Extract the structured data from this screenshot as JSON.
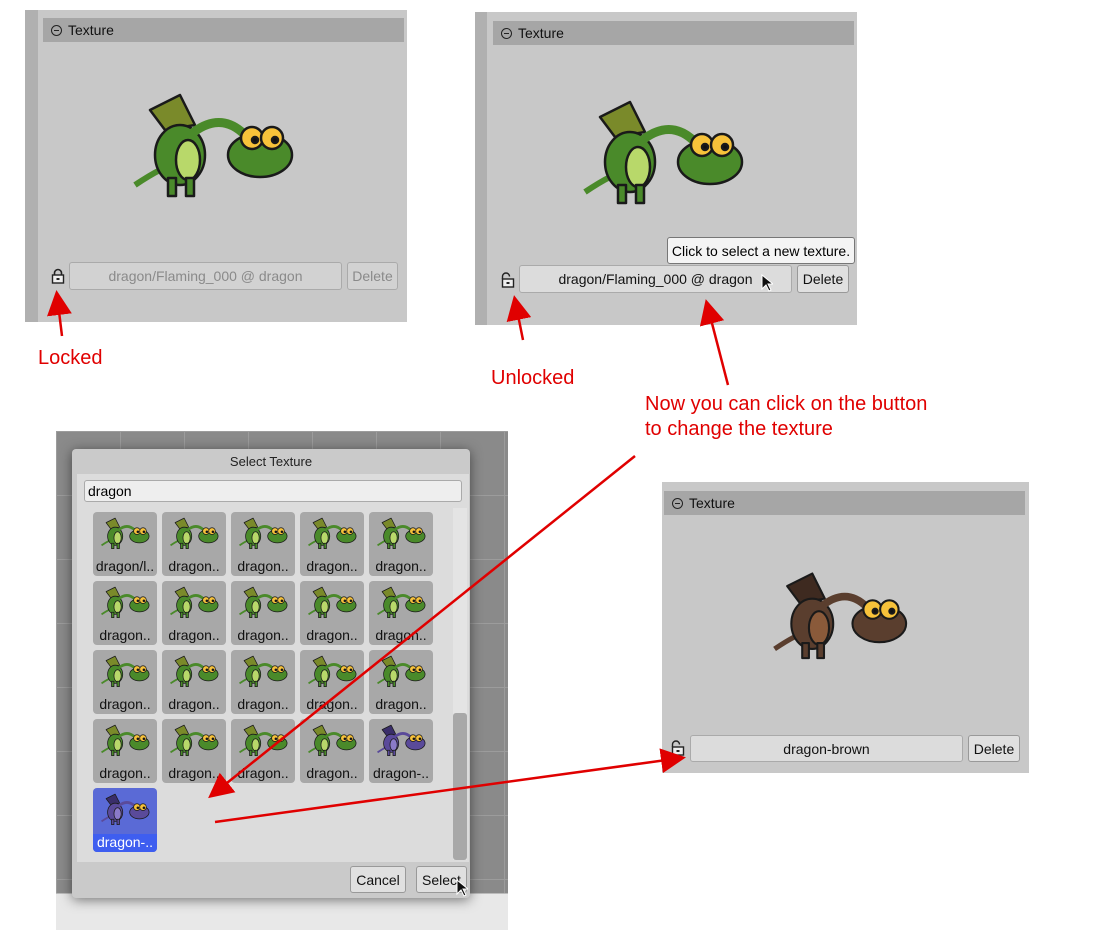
{
  "colors": {
    "annotation": "#e00000",
    "selected": "#3e5ef0",
    "green_dragon": "#4a8a2a",
    "brown_dragon": "#5a3e2e",
    "purple_dragon": "#5a4a9a"
  },
  "panel_locked": {
    "header": "Texture",
    "lock_icon": "lock-icon",
    "texture_button": "dragon/Flaming_000 @ dragon",
    "delete_label": "Delete"
  },
  "panel_unlocked": {
    "header": "Texture",
    "lock_icon": "unlock-icon",
    "texture_button": "dragon/Flaming_000 @ dragon",
    "delete_label": "Delete",
    "tooltip": "Click to select a new texture."
  },
  "panel_changed": {
    "header": "Texture",
    "lock_icon": "unlock-icon",
    "texture_button": "dragon-brown",
    "delete_label": "Delete"
  },
  "annotations": {
    "locked": "Locked",
    "unlocked": "Unlocked",
    "line1": "Now you can click on the button",
    "line2": "to change the texture"
  },
  "dialog": {
    "title": "Select Texture",
    "search_value": "dragon",
    "cancel_label": "Cancel",
    "select_label": "Select",
    "tiles": [
      {
        "label": "dragon/l..",
        "kind": "green"
      },
      {
        "label": "dragon..",
        "kind": "green"
      },
      {
        "label": "dragon..",
        "kind": "green"
      },
      {
        "label": "dragon..",
        "kind": "green"
      },
      {
        "label": "dragon..",
        "kind": "green"
      },
      {
        "label": "dragon..",
        "kind": "green"
      },
      {
        "label": "dragon..",
        "kind": "green"
      },
      {
        "label": "dragon..",
        "kind": "green"
      },
      {
        "label": "dragon..",
        "kind": "green"
      },
      {
        "label": "dragon..",
        "kind": "green"
      },
      {
        "label": "dragon..",
        "kind": "green"
      },
      {
        "label": "dragon..",
        "kind": "green"
      },
      {
        "label": "dragon..",
        "kind": "green"
      },
      {
        "label": "dragon..",
        "kind": "green"
      },
      {
        "label": "dragon..",
        "kind": "green"
      },
      {
        "label": "dragon..",
        "kind": "green"
      },
      {
        "label": "dragon..",
        "kind": "green"
      },
      {
        "label": "dragon..",
        "kind": "green"
      },
      {
        "label": "dragon..",
        "kind": "green"
      },
      {
        "label": "dragon-..",
        "kind": "purple"
      },
      {
        "label": "dragon-..",
        "kind": "purple",
        "selected": true
      }
    ]
  }
}
